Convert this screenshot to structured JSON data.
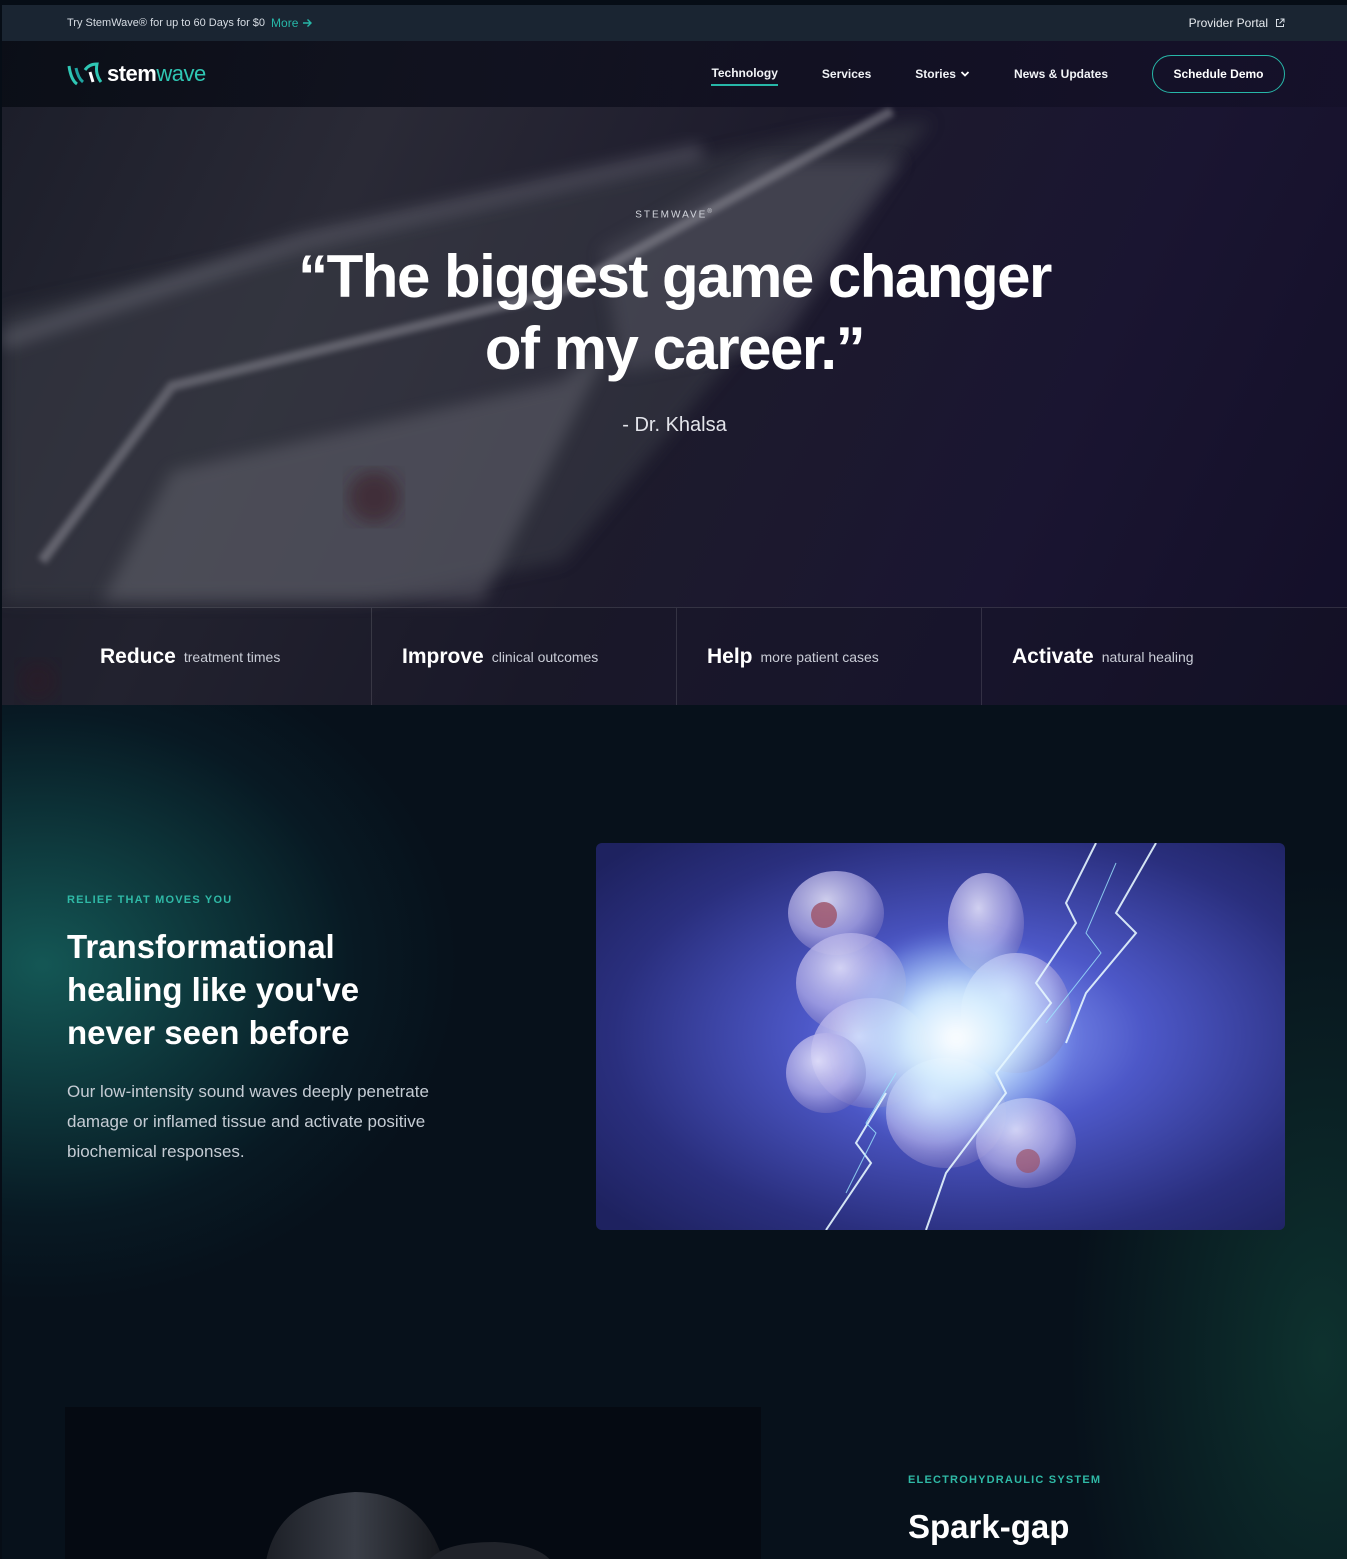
{
  "topbar": {
    "promo_text": "Try StemWave® for up to 60 Days for $0",
    "more_label": "More",
    "provider_portal": "Provider Portal"
  },
  "nav": {
    "logo_stem": "stem",
    "logo_wave": "wave",
    "links": [
      {
        "label": "Technology",
        "active": true
      },
      {
        "label": "Services"
      },
      {
        "label": "Stories",
        "dropdown": true
      },
      {
        "label": "News & Updates"
      }
    ],
    "cta": "Schedule Demo"
  },
  "hero": {
    "eyebrow": "STEMWAVE",
    "quote_line1": "“The biggest game changer",
    "quote_line2": "of my career.”",
    "author": "- Dr. Khalsa"
  },
  "features": [
    {
      "strong": "Reduce",
      "text": "treatment times"
    },
    {
      "strong": "Improve",
      "text": "clinical outcomes"
    },
    {
      "strong": "Help",
      "text": "more patient cases"
    },
    {
      "strong": "Activate",
      "text": "natural healing"
    }
  ],
  "section2": {
    "eyebrow": "RELIEF THAT MOVES YOU",
    "title": "Transformational healing like you've never seen before",
    "body": "Our low-intensity sound waves deeply penetrate damage or inflamed tissue and activate positive biochemical responses."
  },
  "section3": {
    "eyebrow": "ELECTROHYDRAULIC SYSTEM",
    "title": "Spark-gap"
  },
  "colors": {
    "accent": "#27b7a8",
    "topbar_bg": "#1a2532",
    "page_bg": "#07111b"
  },
  "icons": {
    "more": "arrow-right-icon",
    "portal": "external-link-icon",
    "stories": "chevron-down-icon"
  }
}
